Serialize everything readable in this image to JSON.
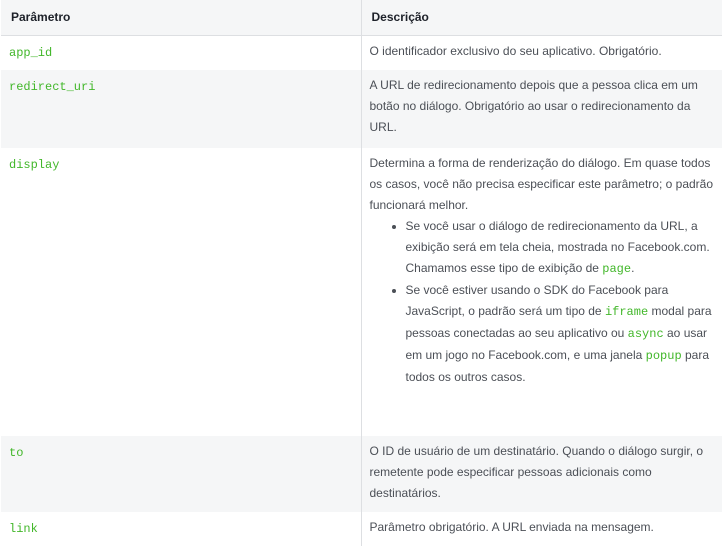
{
  "header": {
    "col1": "Parâmetro",
    "col2": "Descrição"
  },
  "rows": [
    {
      "param": "app_id",
      "desc": "O identificador exclusivo do seu aplicativo. Obrigatório."
    },
    {
      "param": "redirect_uri",
      "desc": "A URL de redirecionamento depois que a pessoa clica em um botão no diálogo. Obrigatório ao usar o redirecionamento da URL."
    },
    {
      "param": "display",
      "desc": "Determina a forma de renderização do diálogo. Em quase todos os casos, você não precisa especificar este parâmetro; o padrão funcionará melhor.",
      "bullet1_text": "Se você usar o diálogo de redirecionamento da URL, a exibição será em tela cheia, mostrada no Facebook.com. Chamamos esse tipo de exibição de ",
      "bullet1_code": "page",
      "bullet1_end": ".",
      "bullet2_a": "Se você estiver usando o SDK do Facebook para JavaScript, o padrão será um tipo de ",
      "bullet2_code1": "iframe",
      "bullet2_b": " modal para pessoas conectadas ao seu aplicativo ou ",
      "bullet2_code2": "async",
      "bullet2_c": " ao usar em um jogo no Facebook.com, e uma janela ",
      "bullet2_code3": "popup",
      "bullet2_d": " para todos os outros casos."
    },
    {
      "param": "to",
      "desc": "O ID de usuário de um destinatário. Quando o diálogo surgir, o remetente pode especificar pessoas adicionais como destinatários."
    },
    {
      "param": "link",
      "desc": "Parâmetro obrigatório. A URL enviada na mensagem."
    }
  ]
}
